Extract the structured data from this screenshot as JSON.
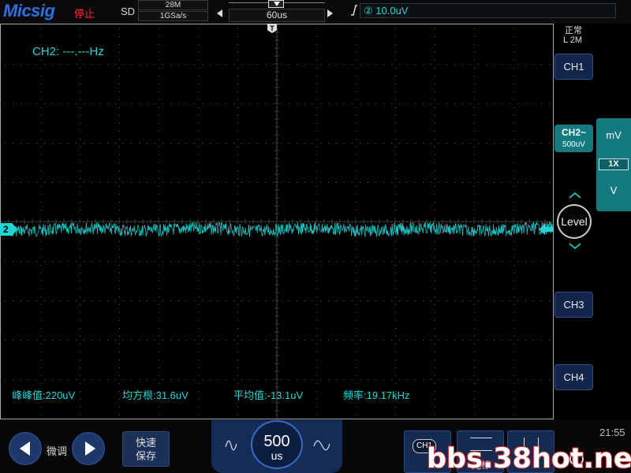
{
  "header": {
    "logo": "Micsig",
    "run_status": "停止",
    "acq_type": "SD",
    "memory_depth": "28M",
    "sample_rate": "1GSa/s",
    "timebase": "60us",
    "trigger_level": "② 10.0uV"
  },
  "status": {
    "acq_mode": "正常",
    "memory_length": "L 2M"
  },
  "display": {
    "frequency_counter": "CH2: ---.---Hz",
    "trigger_marker": "T",
    "ch2_marker": "2",
    "trace_color": "#1fd6d6",
    "measurements": [
      "峰峰值:220uV",
      "均方根:31.6uV",
      "平均值:-13.1uV",
      "频率:19.17kHz"
    ]
  },
  "channels": {
    "ch1": "CH1",
    "ch2": "CH2",
    "ch2_coupling": "~",
    "ch2_scale": "500uV",
    "ch3": "CH3",
    "ch4": "CH4",
    "ch2_color": "#137a80"
  },
  "vscale_panel": {
    "unit_top": "mV",
    "probe": "1X",
    "unit_bottom": "V"
  },
  "level_knob": {
    "label": "Level",
    "up_icon": "chevron-up-icon",
    "down_icon": "chevron-down-icon"
  },
  "footer": {
    "fine_label": "微调",
    "quick_save_line1": "快速",
    "quick_save_line2": "保存",
    "timebase_value": "500",
    "timebase_unit": "us",
    "cursor_badge": "CH1",
    "cursor_label": "光标",
    "clock": "21:55"
  },
  "watermark": "bbs.38hot.net"
}
